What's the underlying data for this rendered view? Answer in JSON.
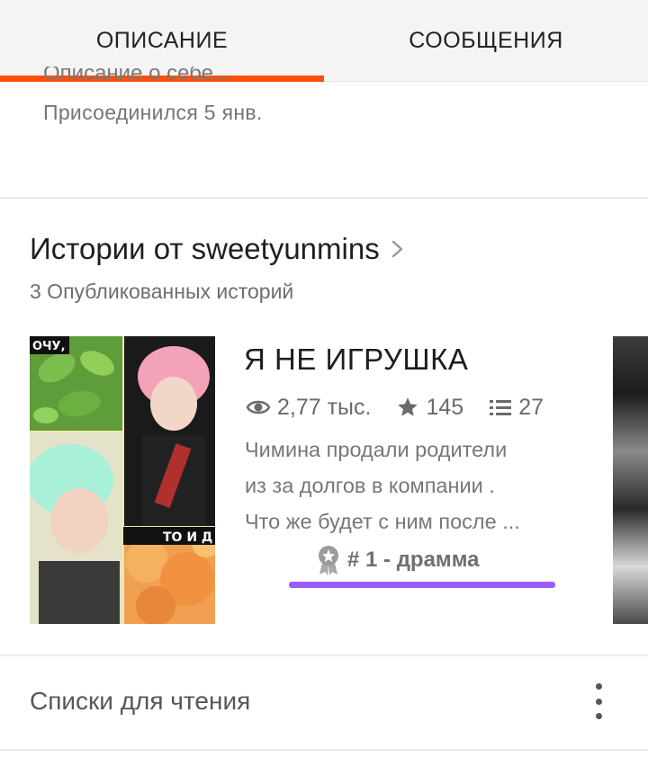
{
  "tabs": [
    {
      "label": "ОПИСАНИЕ",
      "active": true
    },
    {
      "label": "СООБЩЕНИЯ",
      "active": false
    }
  ],
  "accent_color": "#ff500a",
  "about": {
    "description_clipped": "Описание о себе...",
    "joined": "Присоединился 5 янв."
  },
  "stories": {
    "title": "Истории от sweetyunmins",
    "count_text": "3 Опубликованных историй",
    "items": [
      {
        "title": "Я НЕ ИГРУШКА",
        "reads": "2,77 тыс.",
        "votes": "145",
        "parts": "27",
        "description_lines": [
          "Чимина продали родители",
          "из за долгов в компании .",
          "Что же будет с ним после ..."
        ],
        "rank": "# 1 - драмма",
        "cover_text_top": "ОЧУ,",
        "cover_text_mid": "ТО И Д"
      }
    ]
  },
  "reading_lists": {
    "label": "Списки для чтения"
  },
  "icons": [
    "chevron-right-icon",
    "eye-icon",
    "star-icon",
    "list-icon",
    "award-icon",
    "more-vertical-icon"
  ]
}
